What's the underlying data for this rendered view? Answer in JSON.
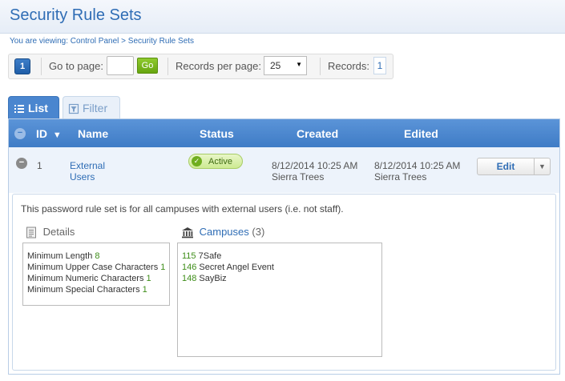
{
  "page": {
    "title": "Security Rule Sets"
  },
  "breadcrumb": {
    "text": "You are viewing: Control Panel > Security Rule Sets"
  },
  "pager": {
    "current_page": "1",
    "goto_label": "Go to page:",
    "goto_value": "",
    "go_label": "Go",
    "rpp_label": "Records per page:",
    "rpp_value": "25",
    "records_label": "Records:",
    "records_value": "1"
  },
  "tabs": [
    {
      "label": "List",
      "active": true,
      "icon": "list-icon"
    },
    {
      "label": "Filter",
      "active": false,
      "icon": "filter-icon"
    }
  ],
  "grid": {
    "columns": {
      "id": "ID",
      "name": "Name",
      "status": "Status",
      "created": "Created",
      "edited": "Edited"
    },
    "sort_indicator": "▼",
    "rows": [
      {
        "id": "1",
        "name_line1": "External",
        "name_line2": "Users",
        "status": "Active",
        "created_date": "8/12/2014 10:25 AM",
        "created_by": "Sierra Trees",
        "edited_date": "8/12/2014 10:25 AM",
        "edited_by": "Sierra Trees",
        "edit_label": "Edit"
      }
    ]
  },
  "detail": {
    "description": "This password rule set is for all campuses with external users (i.e. not staff).",
    "details_title": "Details",
    "details": [
      {
        "label": "Minimum Length",
        "value": "8"
      },
      {
        "label": "Minimum Upper Case Characters",
        "value": "1"
      },
      {
        "label": "Minimum Numeric Characters",
        "value": "1"
      },
      {
        "label": "Minimum Special Characters",
        "value": "1"
      }
    ],
    "campuses_title": "Campuses",
    "campuses_count": "(3)",
    "campuses": [
      {
        "id": "115",
        "name": "7Safe"
      },
      {
        "id": "146",
        "name": "Secret Angel Event"
      },
      {
        "id": "148",
        "name": "SayBiz"
      }
    ]
  },
  "colors": {
    "accent": "#2f6db5",
    "header": "#4a86cf",
    "success": "#6fae1f",
    "go_button": "#7ab820"
  }
}
